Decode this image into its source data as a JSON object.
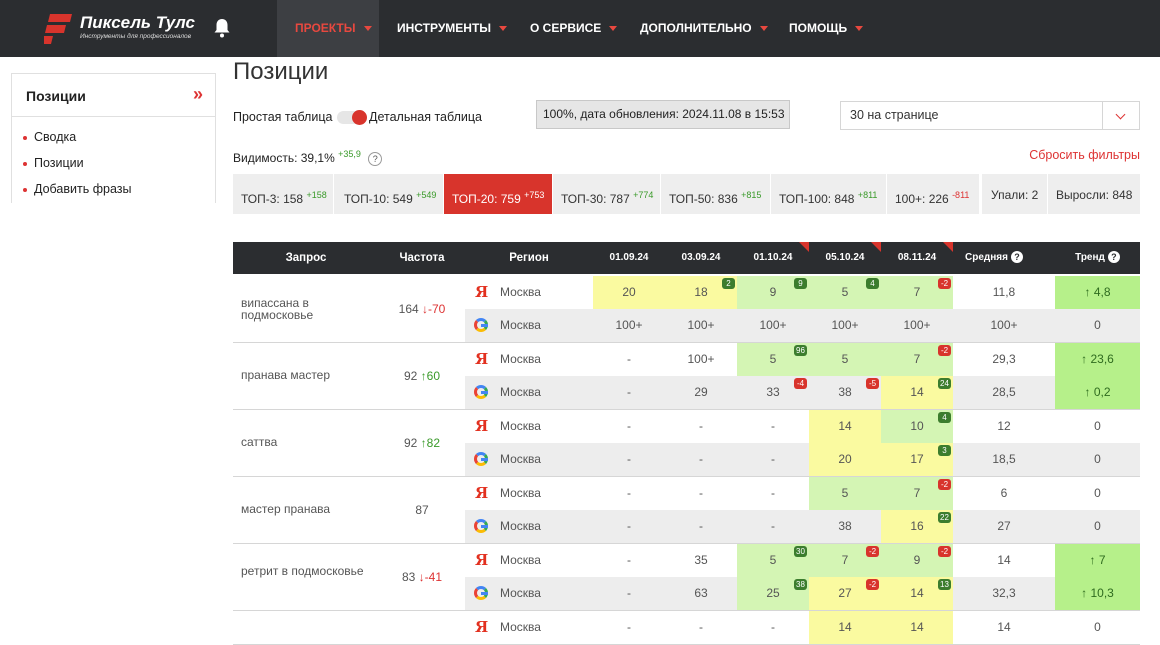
{
  "logo": {
    "name": "Пиксель Тулс",
    "tagline": "Инструменты для профессионалов"
  },
  "nav": [
    "ПРОЕКТЫ",
    "ИНСТРУМЕНТЫ",
    "О СЕРВИСЕ",
    "ДОПОЛНИТЕЛЬНО",
    "ПОМОЩЬ"
  ],
  "sidebar": {
    "title": "Позиции",
    "items": [
      "Сводка",
      "Позиции",
      "Добавить фразы"
    ]
  },
  "page_title": "Позиции",
  "toggle": {
    "simple": "Простая таблица",
    "detail": "Детальная таблица"
  },
  "update_status": "100%, дата обновления: 2024.11.08 в 15:53",
  "per_page": "30 на странице",
  "visibility": {
    "label": "Видимость: 39,1%",
    "delta": "+35,9",
    "help": "?"
  },
  "reset_filters": "Сбросить фильтры",
  "tops": [
    {
      "label": "ТОП-3: 158",
      "delta": "+158"
    },
    {
      "label": "ТОП-10: 549",
      "delta": "+549"
    },
    {
      "label": "ТОП-20: 759",
      "delta": "+753"
    },
    {
      "label": "ТОП-30: 787",
      "delta": "+774"
    },
    {
      "label": "ТОП-50: 836",
      "delta": "+815"
    },
    {
      "label": "ТОП-100: 848",
      "delta": "+811"
    },
    {
      "label": "100+: 226",
      "delta": "-811"
    }
  ],
  "fell": "Упали: 2",
  "grew": "Выросли: 848",
  "headers": {
    "query": "Запрос",
    "freq": "Частота",
    "region": "Регион",
    "dates": [
      "01.09.24",
      "03.09.24",
      "01.10.24",
      "05.10.24",
      "08.11.24"
    ],
    "avg": "Средняя",
    "trend": "Тренд"
  },
  "colors": {
    "accent": "#d8342c",
    "header": "#2b2d30",
    "yellow": "#fafaa0",
    "green": "#d4f5b4",
    "trend_green": "#b6f08a"
  },
  "rows": [
    {
      "query": "випассана в подмосковье",
      "freq": "164",
      "freq_delta": "↓-70",
      "freq_dir": "dn",
      "engines": [
        {
          "engine": "yandex",
          "region": "Москва",
          "cells": [
            [
              "20",
              "y",
              ""
            ],
            [
              "18",
              "y",
              "2"
            ],
            [
              "9",
              "g",
              "9"
            ],
            [
              "5",
              "g",
              "4"
            ],
            [
              "7",
              "g",
              "-2"
            ]
          ],
          "avg": "11,8",
          "trend": "↑ 4,8",
          "trend_hl": true
        },
        {
          "engine": "google",
          "region": "Москва",
          "cells": [
            [
              "100+",
              "",
              ""
            ],
            [
              "100+",
              "",
              ""
            ],
            [
              "100+",
              "",
              ""
            ],
            [
              "100+",
              "",
              ""
            ],
            [
              "100+",
              "",
              ""
            ]
          ],
          "avg": "100+",
          "trend": "0",
          "trend_hl": false
        }
      ]
    },
    {
      "query": "пранава мастер",
      "freq": "92",
      "freq_delta": "↑60",
      "freq_dir": "up",
      "engines": [
        {
          "engine": "yandex",
          "region": "Москва",
          "cells": [
            [
              "-",
              "",
              ""
            ],
            [
              "100+",
              "",
              ""
            ],
            [
              "5",
              "g",
              "96"
            ],
            [
              "5",
              "g",
              ""
            ],
            [
              "7",
              "g",
              "-2"
            ]
          ],
          "avg": "29,3",
          "trend": "↑ 23,6",
          "trend_hl": true
        },
        {
          "engine": "google",
          "region": "Москва",
          "cells": [
            [
              "-",
              "",
              ""
            ],
            [
              "29",
              "",
              ""
            ],
            [
              "33",
              "",
              "-4"
            ],
            [
              "38",
              "",
              "-5"
            ],
            [
              "14",
              "y",
              "24"
            ]
          ],
          "avg": "28,5",
          "trend": "↑ 0,2",
          "trend_hl": true
        }
      ]
    },
    {
      "query": "саттва",
      "freq": "92",
      "freq_delta": "↑82",
      "freq_dir": "up",
      "engines": [
        {
          "engine": "yandex",
          "region": "Москва",
          "cells": [
            [
              "-",
              "",
              ""
            ],
            [
              "-",
              "",
              ""
            ],
            [
              "-",
              "",
              ""
            ],
            [
              "14",
              "y",
              ""
            ],
            [
              "10",
              "g",
              "4"
            ]
          ],
          "avg": "12",
          "trend": "0",
          "trend_hl": false
        },
        {
          "engine": "google",
          "region": "Москва",
          "cells": [
            [
              "-",
              "",
              ""
            ],
            [
              "-",
              "",
              ""
            ],
            [
              "-",
              "",
              ""
            ],
            [
              "20",
              "y",
              ""
            ],
            [
              "17",
              "y",
              "3"
            ]
          ],
          "avg": "18,5",
          "trend": "0",
          "trend_hl": false
        }
      ]
    },
    {
      "query": "мастер пранава",
      "freq": "87",
      "freq_delta": "",
      "freq_dir": "",
      "engines": [
        {
          "engine": "yandex",
          "region": "Москва",
          "cells": [
            [
              "-",
              "",
              ""
            ],
            [
              "-",
              "",
              ""
            ],
            [
              "-",
              "",
              ""
            ],
            [
              "5",
              "g",
              ""
            ],
            [
              "7",
              "g",
              "-2"
            ]
          ],
          "avg": "6",
          "trend": "0",
          "trend_hl": false
        },
        {
          "engine": "google",
          "region": "Москва",
          "cells": [
            [
              "-",
              "",
              ""
            ],
            [
              "-",
              "",
              ""
            ],
            [
              "-",
              "",
              ""
            ],
            [
              "38",
              "",
              ""
            ],
            [
              "16",
              "y",
              "22"
            ]
          ],
          "avg": "27",
          "trend": "0",
          "trend_hl": false
        }
      ]
    },
    {
      "query": "ретрит в подмосковье",
      "freq": "83",
      "freq_delta": "↓-41",
      "freq_dir": "dn",
      "engines": [
        {
          "engine": "yandex",
          "region": "Москва",
          "cells": [
            [
              "-",
              "",
              ""
            ],
            [
              "35",
              "",
              ""
            ],
            [
              "5",
              "g",
              "30"
            ],
            [
              "7",
              "g",
              "-2"
            ],
            [
              "9",
              "g",
              "-2"
            ]
          ],
          "avg": "14",
          "trend": "↑ 7",
          "trend_hl": true
        },
        {
          "engine": "google",
          "region": "Москва",
          "cells": [
            [
              "-",
              "",
              ""
            ],
            [
              "63",
              "",
              ""
            ],
            [
              "25",
              "g",
              "38"
            ],
            [
              "27",
              "y",
              "-2"
            ],
            [
              "14",
              "y",
              "13"
            ]
          ],
          "avg": "32,3",
          "trend": "↑ 10,3",
          "trend_hl": true
        }
      ]
    },
    {
      "query": "",
      "freq": "",
      "freq_delta": "",
      "freq_dir": "",
      "engines": [
        {
          "engine": "yandex",
          "region": "Москва",
          "cells": [
            [
              "-",
              "",
              ""
            ],
            [
              "-",
              "",
              ""
            ],
            [
              "-",
              "",
              ""
            ],
            [
              "14",
              "y",
              ""
            ],
            [
              "14",
              "y",
              ""
            ]
          ],
          "avg": "14",
          "trend": "0",
          "trend_hl": false
        }
      ]
    }
  ]
}
